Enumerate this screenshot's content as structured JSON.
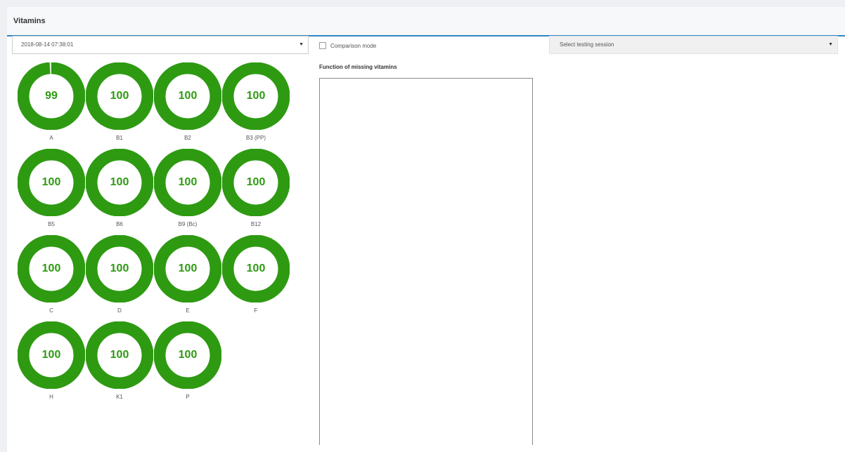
{
  "header": {
    "title": "Vitamins"
  },
  "date_select": {
    "value": "2018-08-14 07:38:01"
  },
  "comparison": {
    "label": "Comparison mode"
  },
  "functions": {
    "title": "Function of missing vitamins"
  },
  "session_select": {
    "placeholder": "Select testing session"
  },
  "colors": {
    "ring": "#2e9a12",
    "ring_track": "#dff0d8",
    "accent": "#2f88c8"
  },
  "vitamins": [
    {
      "label": "A",
      "value": 99
    },
    {
      "label": "B1",
      "value": 100
    },
    {
      "label": "B2",
      "value": 100
    },
    {
      "label": "B3 (PP)",
      "value": 100
    },
    {
      "label": "B5",
      "value": 100
    },
    {
      "label": "B6",
      "value": 100
    },
    {
      "label": "B9 (Bc)",
      "value": 100
    },
    {
      "label": "B12",
      "value": 100
    },
    {
      "label": "C",
      "value": 100
    },
    {
      "label": "D",
      "value": 100
    },
    {
      "label": "E",
      "value": 100
    },
    {
      "label": "F",
      "value": 100
    },
    {
      "label": "H",
      "value": 100
    },
    {
      "label": "K1",
      "value": 100
    },
    {
      "label": "P",
      "value": 100
    }
  ]
}
